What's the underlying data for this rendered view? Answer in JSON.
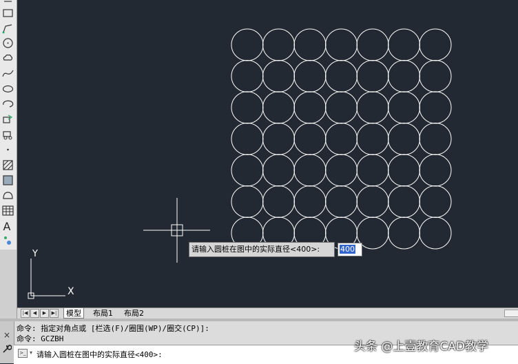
{
  "canvas": {
    "ucs_y_label": "Y",
    "ucs_x_label": "X",
    "circle_grid": {
      "rows": 7,
      "cols": 7
    }
  },
  "prompt": {
    "text": "请输入圆桩在图中的实际直径<400>:",
    "value": "400"
  },
  "tabs": {
    "nav": [
      "|◀",
      "◀",
      "▶",
      "▶|"
    ],
    "items": [
      {
        "label": "模型",
        "active": true
      },
      {
        "label": "布局1",
        "active": false
      },
      {
        "label": "布局2",
        "active": false
      }
    ]
  },
  "command": {
    "history": [
      "命令: 指定对角点或 [栏选(F)/圈围(WP)/圈交(CP)]:",
      "命令: GCZBH"
    ],
    "input": "请输入圆桩在图中的实际直径<400>:",
    "close_glyph": "×"
  },
  "watermark": "头条 @上壹教育CAD教学",
  "toolbar": {
    "text_tool_glyph": "A",
    "icons": [
      "rectangle-icon",
      "polyline-icon",
      "circle-icon",
      "revision-cloud-icon",
      "spline-icon",
      "ellipse-icon",
      "ellipse-arc-icon",
      "insert-block-icon",
      "make-block-icon",
      "point-icon",
      "hatch-icon",
      "gradient-icon",
      "region-icon",
      "table-icon",
      "multiline-text-icon",
      "add-selected-icon"
    ]
  }
}
